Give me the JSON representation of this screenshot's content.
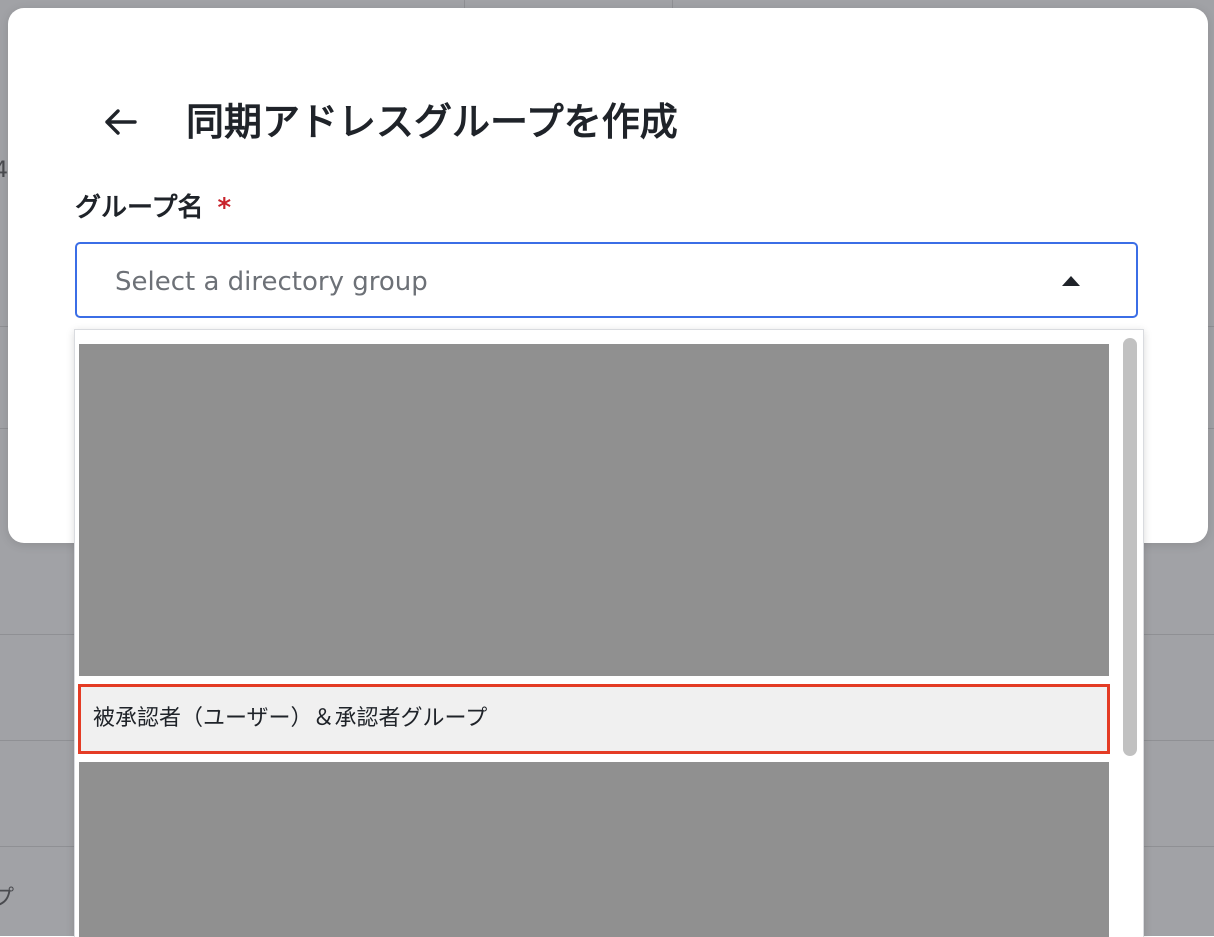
{
  "dialog": {
    "title": "同期アドレスグループを作成",
    "back_icon": "arrow-left-icon"
  },
  "group_field": {
    "label": "グループ名",
    "required_marker": "*",
    "placeholder": "Select a directory group",
    "caret_icon": "caret-up-icon"
  },
  "dropdown": {
    "highlighted_option": "被承認者（ユーザー）＆承認者グループ"
  },
  "background": {
    "fragment_1": "4",
    "fragment_2": "プ"
  },
  "colors": {
    "focus_border": "#3b6ee6",
    "required": "#c8232c",
    "highlight_border": "#e43c25",
    "redaction": "#909090"
  }
}
